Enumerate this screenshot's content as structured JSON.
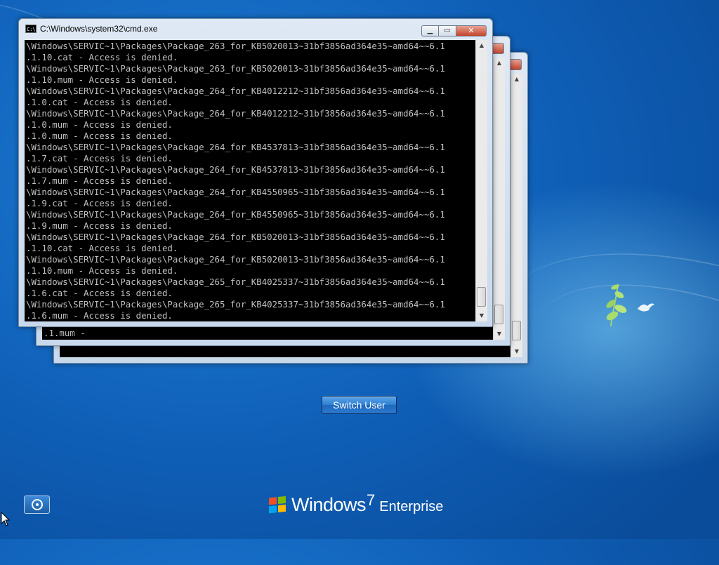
{
  "main_window": {
    "title": "C:\\Windows\\system32\\cmd.exe",
    "icon_text": "C:\\",
    "console_lines": [
      "\\Windows\\SERVIC~1\\Packages\\Package_263_for_KB5020013~31bf3856ad364e35~amd64~~6.1",
      ".1.10.cat - Access is denied.",
      "\\Windows\\SERVIC~1\\Packages\\Package_263_for_KB5020013~31bf3856ad364e35~amd64~~6.1",
      ".1.10.mum - Access is denied.",
      "\\Windows\\SERVIC~1\\Packages\\Package_264_for_KB4012212~31bf3856ad364e35~amd64~~6.1",
      ".1.0.cat - Access is denied.",
      "\\Windows\\SERVIC~1\\Packages\\Package_264_for_KB4012212~31bf3856ad364e35~amd64~~6.1",
      ".1.0.mum - Access is denied.",
      ".1.0.mum - Access is denied.",
      "\\Windows\\SERVIC~1\\Packages\\Package_264_for_KB4537813~31bf3856ad364e35~amd64~~6.1",
      ".1.7.cat - Access is denied.",
      "\\Windows\\SERVIC~1\\Packages\\Package_264_for_KB4537813~31bf3856ad364e35~amd64~~6.1",
      ".1.7.mum - Access is denied.",
      "\\Windows\\SERVIC~1\\Packages\\Package_264_for_KB4550965~31bf3856ad364e35~amd64~~6.1",
      ".1.9.cat - Access is denied.",
      "\\Windows\\SERVIC~1\\Packages\\Package_264_for_KB4550965~31bf3856ad364e35~amd64~~6.1",
      ".1.9.mum - Access is denied.",
      "\\Windows\\SERVIC~1\\Packages\\Package_264_for_KB5020013~31bf3856ad364e35~amd64~~6.1",
      ".1.10.cat - Access is denied.",
      "\\Windows\\SERVIC~1\\Packages\\Package_264_for_KB5020013~31bf3856ad364e35~amd64~~6.1",
      ".1.10.mum - Access is denied.",
      "\\Windows\\SERVIC~1\\Packages\\Package_265_for_KB4025337~31bf3856ad364e35~amd64~~6.1",
      ".1.6.cat - Access is denied.",
      "\\Windows\\SERVIC~1\\Packages\\Package_265_for_KB4025337~31bf3856ad364e35~amd64~~6.1",
      ".1.6.mum - Access is denied."
    ]
  },
  "back_window": {
    "visible_line": ".1.mum -"
  },
  "switch_user_label": "Switch User",
  "branding": {
    "name": "Windows",
    "version": "7",
    "edition": "Enterprise"
  },
  "icons": {
    "window_icon": "cmd-icon",
    "ease_of_access": "ease-of-access-icon",
    "cursor": "mouse-cursor-icon",
    "logo": "windows-flag-icon"
  },
  "colors": {
    "console_bg": "#000000",
    "console_text": "#c0c0c0",
    "desktop_blue": "#1565c0",
    "close_button": "#c4432b"
  }
}
